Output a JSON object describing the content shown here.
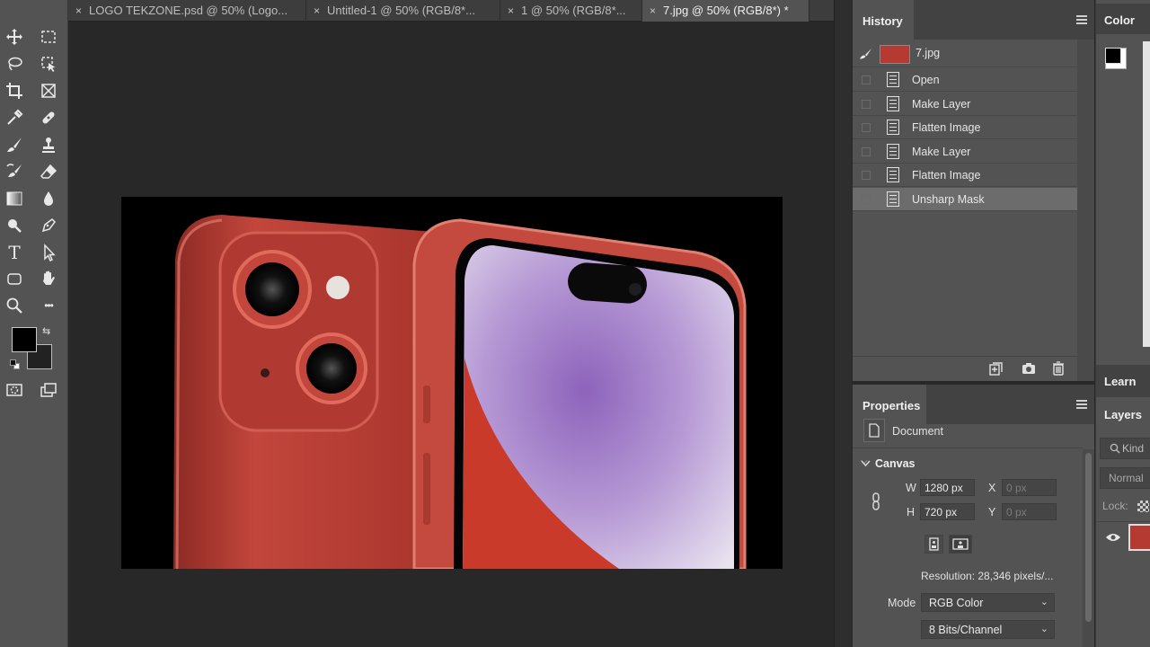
{
  "tabs": [
    {
      "label": "LOGO TEKZONE.psd @ 50% (Logo...",
      "close": "×"
    },
    {
      "label": "Untitled-1 @ 50% (RGB/8*...",
      "close": "×"
    },
    {
      "label": "1 @ 50% (RGB/8*...",
      "close": "×"
    },
    {
      "label": "7.jpg @ 50% (RGB/8*) *",
      "close": "×"
    }
  ],
  "tools": [
    "move-tool",
    "marquee-tool",
    "lasso-tool",
    "object-select-tool",
    "crop-tool",
    "frame-tool",
    "eyedropper-tool",
    "healing-tool",
    "brush-tool",
    "stamp-tool",
    "history-brush-tool",
    "eraser-tool",
    "gradient-tool",
    "blur-tool",
    "dodge-tool",
    "pen-tool",
    "type-tool",
    "path-select-tool",
    "shape-tool",
    "hand-tool",
    "zoom-tool",
    "more-tools"
  ],
  "toolbar": {
    "type_glyph": "T",
    "more_glyph": "•••",
    "swap_glyph": "⇆"
  },
  "history": {
    "title": "History",
    "snapshot_label": "7.jpg",
    "items": [
      "Open",
      "Make Layer",
      "Flatten Image",
      "Make Layer",
      "Flatten Image",
      "Unsharp Mask"
    ],
    "selected_index": 5
  },
  "properties": {
    "title": "Properties",
    "kind_label": "Document",
    "section_label": "Canvas",
    "w_label": "W",
    "w_value": "1280 px",
    "h_label": "H",
    "h_value": "720 px",
    "x_label": "X",
    "x_value": "0 px",
    "y_label": "Y",
    "y_value": "0 px",
    "resolution": "Resolution: 28,346 pixels/...",
    "mode_label": "Mode",
    "mode_value": "RGB Color",
    "depth_value": "8 Bits/Channel"
  },
  "right_dock": {
    "color_title": "Color",
    "learn_title": "Learn",
    "layers_title": "Layers",
    "kind_placeholder": "Kind",
    "blend_mode": "Normal",
    "lock_label": "Lock:"
  },
  "colors": {
    "accent_red": "#c23a30",
    "screen_purple": "#a887c8",
    "panel_bg": "#535353"
  }
}
